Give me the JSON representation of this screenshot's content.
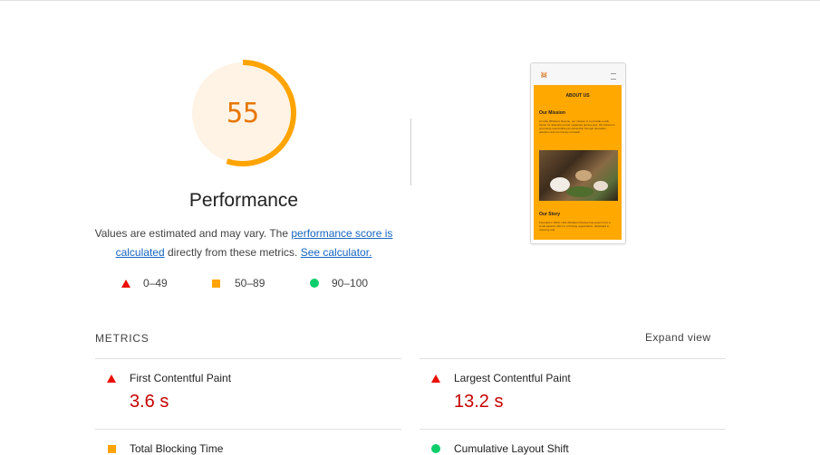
{
  "gauge": {
    "score": "55",
    "fraction": 0.55,
    "ring_color": "#ffa400",
    "bg_color": "#fff3e6",
    "text_color": "#e67700"
  },
  "category": {
    "title": "Performance",
    "desc_prefix": "Values are estimated and may vary. The ",
    "link_perf_score": "performance score is calculated",
    "desc_middle": " directly from these metrics. ",
    "link_calculator": "See calculator."
  },
  "legend": {
    "fail": "0–49",
    "average": "50–89",
    "pass": "90–100"
  },
  "screenshot": {
    "about_heading": "ABOUT US",
    "mission_heading": "Our Mission",
    "mission_text": "At Little Whiskers Rescue, our mission is to provide a safe haven for abandoned and neglected guinea pigs. We believe in promoting responsible pet ownership through education, adoption and community outreach.",
    "story_heading": "Our Story",
    "story_text": "Founded in 2020, Little Whiskers Rescue has grown from a small passion effort to a thriving organization, dedicated to rescuing and"
  },
  "metrics": {
    "heading": "METRICS",
    "expand_label": "Expand view",
    "items": [
      {
        "label": "First Contentful Paint",
        "value": "3.6 s",
        "status": "fail"
      },
      {
        "label": "Largest Contentful Paint",
        "value": "13.2 s",
        "status": "fail"
      },
      {
        "label": "Total Blocking Time",
        "value": "",
        "status": "average"
      },
      {
        "label": "Cumulative Layout Shift",
        "value": "",
        "status": "pass"
      }
    ]
  },
  "colors": {
    "fail": "#eb0f00",
    "average": "#ffa400",
    "pass": "#0cce6b",
    "value_fail": "#c70000",
    "link": "#1565c0"
  }
}
